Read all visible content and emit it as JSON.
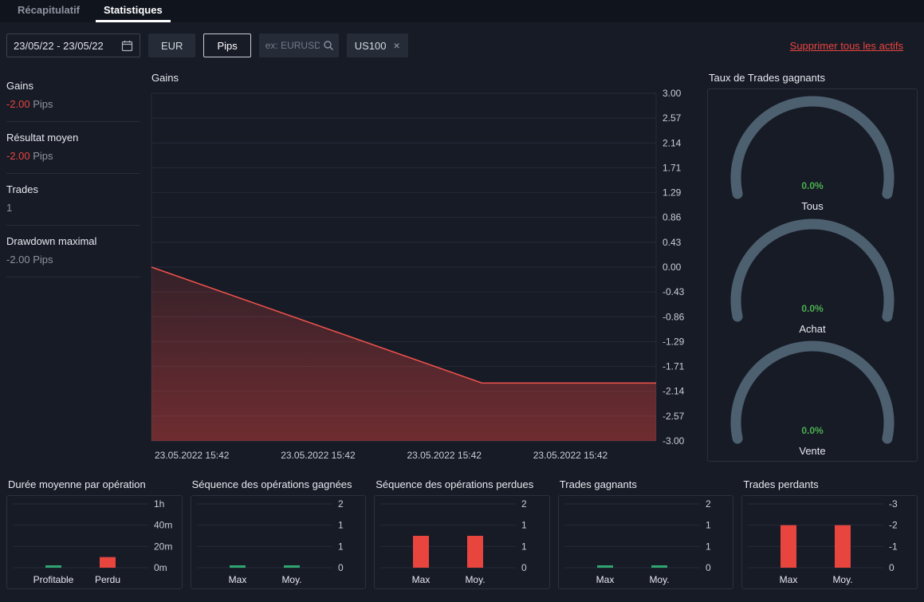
{
  "colors": {
    "background": "#171b26",
    "accent_red": "#e8453f",
    "accent_green": "#4caf50",
    "bar_green": "#2fa572",
    "gauge_arc": "#4d6070"
  },
  "tabs": [
    {
      "label": "Récapitulatif",
      "active": false
    },
    {
      "label": "Statistiques",
      "active": true
    }
  ],
  "toolbar": {
    "date_range": "23/05/22 - 23/05/22",
    "currency_label": "EUR",
    "pips_label": "Pips",
    "search_placeholder": "ex: EURUSD",
    "symbol_chip": "US100",
    "remove_symbol": "×",
    "delete_all_label": "Supprimer tous les actifs"
  },
  "stats": {
    "items": [
      {
        "label": "Gains",
        "value": "-2.00",
        "unit": "Pips",
        "value_color": "#e8453f"
      },
      {
        "label": "Résultat moyen",
        "value": "-2.00",
        "unit": "Pips",
        "value_color": "#e8453f"
      },
      {
        "label": "Trades",
        "value": "1",
        "unit": "",
        "value_color": "#8d93a0"
      },
      {
        "label": "Drawdown maximal",
        "value": "-2.00",
        "unit": "Pips",
        "value_color": "#8d93a0"
      }
    ]
  },
  "gauges": {
    "title": "Taux de Trades gagnants",
    "items": [
      {
        "value": "0.0%",
        "label": "Tous"
      },
      {
        "value": "0.0%",
        "label": "Achat"
      },
      {
        "value": "0.0%",
        "label": "Vente"
      }
    ]
  },
  "chart_data": [
    {
      "id": "gains",
      "type": "area",
      "title": "Gains",
      "x_labels": [
        "23.05.2022 15:42",
        "23.05.2022 15:42",
        "23.05.2022 15:42",
        "23.05.2022 15:42"
      ],
      "y_ticks": [
        "3.00",
        "2.57",
        "2.14",
        "1.71",
        "1.29",
        "0.86",
        "0.43",
        "0.00",
        "-0.43",
        "-0.86",
        "-1.29",
        "-1.71",
        "-2.14",
        "-2.57",
        "-3.00"
      ],
      "ylim": [
        -3,
        3
      ],
      "points": [
        [
          0,
          0
        ],
        [
          0.655,
          -2
        ],
        [
          1,
          -2
        ]
      ],
      "line_color": "#f0524c",
      "fill_color": "#e8453f",
      "grid": true,
      "legend": "none"
    },
    {
      "id": "duration",
      "type": "bar",
      "title": "Durée moyenne par opération",
      "categories": [
        "Profitable",
        "Perdu"
      ],
      "values": [
        2,
        10
      ],
      "bar_colors": [
        "#2fa572",
        "#e8453f"
      ],
      "y_ticks": [
        "1h",
        "40m",
        "20m",
        "0m"
      ],
      "y_range": 60
    },
    {
      "id": "win-sequence",
      "type": "bar",
      "title": "Séquence des opérations gagnées",
      "categories": [
        "Max",
        "Moy."
      ],
      "values": [
        0,
        0
      ],
      "bar_colors": [
        "#2fa572",
        "#2fa572"
      ],
      "y_ticks": [
        "2",
        "1",
        "1",
        "0"
      ],
      "y_range": 2
    },
    {
      "id": "lose-sequence",
      "type": "bar",
      "title": "Séquence des opérations perdues",
      "categories": [
        "Max",
        "Moy."
      ],
      "values": [
        1,
        1
      ],
      "bar_colors": [
        "#e8453f",
        "#e8453f"
      ],
      "y_ticks": [
        "2",
        "1",
        "1",
        "0"
      ],
      "y_range": 2
    },
    {
      "id": "winning-trades",
      "type": "bar",
      "title": "Trades gagnants",
      "categories": [
        "Max",
        "Moy."
      ],
      "values": [
        0,
        0
      ],
      "bar_colors": [
        "#2fa572",
        "#2fa572"
      ],
      "y_ticks": [
        "2",
        "1",
        "1",
        "0"
      ],
      "y_range": 2
    },
    {
      "id": "losing-trades",
      "type": "bar",
      "title": "Trades perdants",
      "categories": [
        "Max",
        "Moy."
      ],
      "values": [
        -2,
        -2
      ],
      "bar_colors": [
        "#e8453f",
        "#e8453f"
      ],
      "y_ticks": [
        "-3",
        "-2",
        "-1",
        "0"
      ],
      "y_range": 3
    }
  ]
}
